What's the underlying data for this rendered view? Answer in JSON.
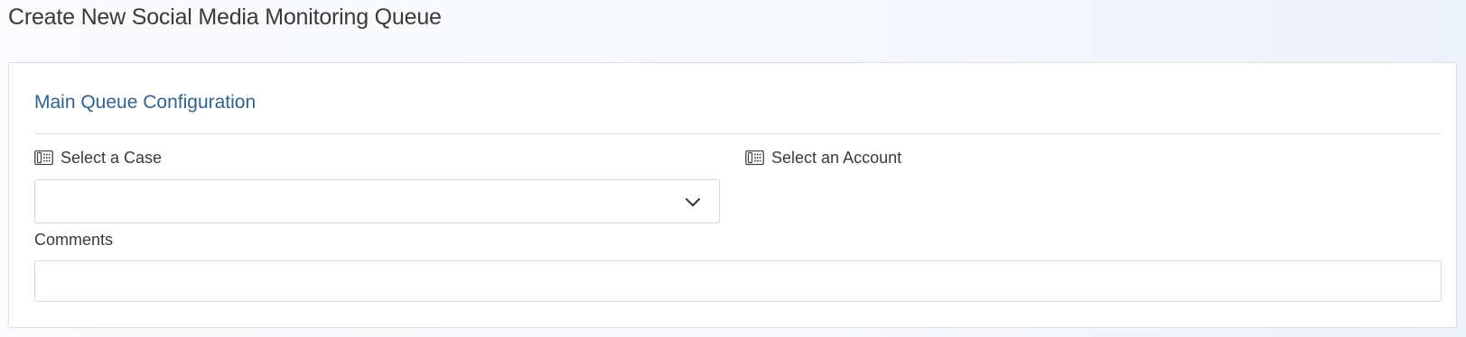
{
  "header": {
    "title": "Create New Social Media Monitoring Queue"
  },
  "form": {
    "section_title": "Main Queue Configuration",
    "case_field": {
      "label": "Select a Case",
      "value": "",
      "icon": "phone-keypad-icon"
    },
    "account_field": {
      "label": "Select an Account",
      "icon": "phone-keypad-icon"
    },
    "comments_field": {
      "label": "Comments",
      "value": "",
      "placeholder": ""
    }
  },
  "colors": {
    "section_title": "#2f6391",
    "border": "#d4d7dc",
    "text": "#3a3a3a"
  }
}
